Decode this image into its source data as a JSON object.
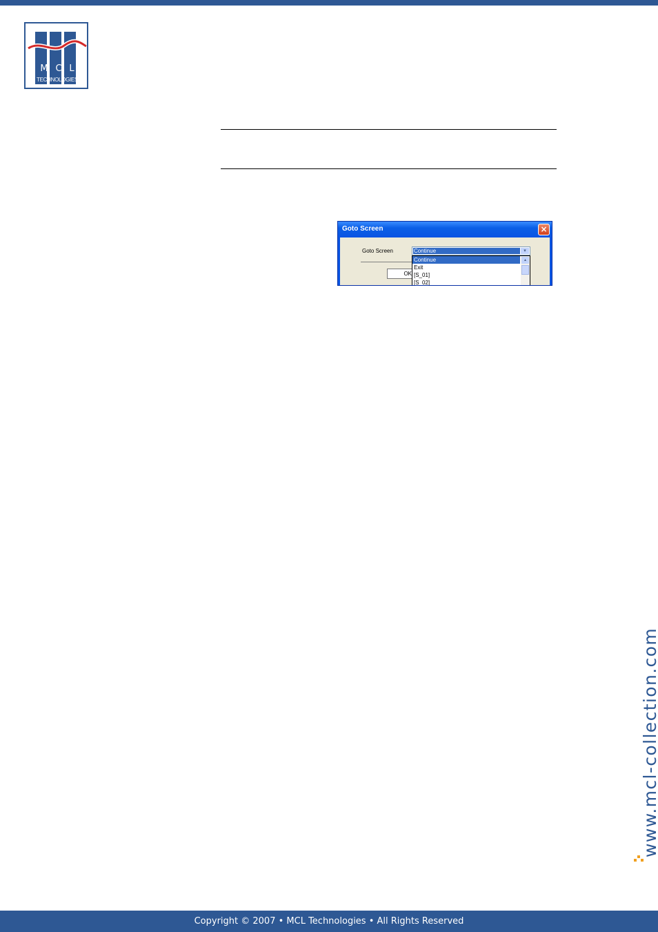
{
  "logo": {
    "letters": [
      "M",
      "C",
      "L"
    ],
    "subtitle": "TECHNOLOGIES",
    "colors": {
      "blue": "#2e5894",
      "red": "#d42a2a"
    }
  },
  "dialog": {
    "title": "Goto Screen",
    "close_glyph": "×",
    "field_label": "Goto Screen",
    "selected_value": "Continue",
    "dropdown_arrow": "▾",
    "options": [
      "Continue",
      "Exit",
      "[S_01]",
      "[S_02]"
    ],
    "ok_label": "OK",
    "scroll_up_glyph": "▴"
  },
  "sidebar": {
    "url": "www.mcl-collection.com"
  },
  "footer": {
    "copyright": "Copyright © 2007 • MCL Technologies • All Rights Reserved"
  },
  "colors": {
    "brand_blue": "#2e5894",
    "accent_orange": "#f0a020",
    "xp_title_blue": "#0a54e3"
  }
}
